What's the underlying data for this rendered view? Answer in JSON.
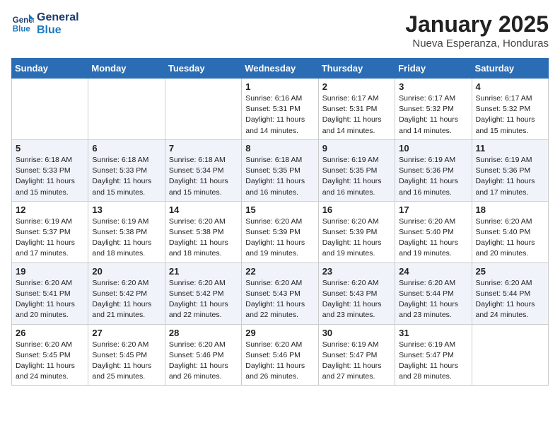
{
  "logo": {
    "line1": "General",
    "line2": "Blue"
  },
  "title": "January 2025",
  "location": "Nueva Esperanza, Honduras",
  "days_of_week": [
    "Sunday",
    "Monday",
    "Tuesday",
    "Wednesday",
    "Thursday",
    "Friday",
    "Saturday"
  ],
  "weeks": [
    [
      {
        "day": "",
        "info": ""
      },
      {
        "day": "",
        "info": ""
      },
      {
        "day": "",
        "info": ""
      },
      {
        "day": "1",
        "info": "Sunrise: 6:16 AM\nSunset: 5:31 PM\nDaylight: 11 hours and 14 minutes."
      },
      {
        "day": "2",
        "info": "Sunrise: 6:17 AM\nSunset: 5:31 PM\nDaylight: 11 hours and 14 minutes."
      },
      {
        "day": "3",
        "info": "Sunrise: 6:17 AM\nSunset: 5:32 PM\nDaylight: 11 hours and 14 minutes."
      },
      {
        "day": "4",
        "info": "Sunrise: 6:17 AM\nSunset: 5:32 PM\nDaylight: 11 hours and 15 minutes."
      }
    ],
    [
      {
        "day": "5",
        "info": "Sunrise: 6:18 AM\nSunset: 5:33 PM\nDaylight: 11 hours and 15 minutes."
      },
      {
        "day": "6",
        "info": "Sunrise: 6:18 AM\nSunset: 5:33 PM\nDaylight: 11 hours and 15 minutes."
      },
      {
        "day": "7",
        "info": "Sunrise: 6:18 AM\nSunset: 5:34 PM\nDaylight: 11 hours and 15 minutes."
      },
      {
        "day": "8",
        "info": "Sunrise: 6:18 AM\nSunset: 5:35 PM\nDaylight: 11 hours and 16 minutes."
      },
      {
        "day": "9",
        "info": "Sunrise: 6:19 AM\nSunset: 5:35 PM\nDaylight: 11 hours and 16 minutes."
      },
      {
        "day": "10",
        "info": "Sunrise: 6:19 AM\nSunset: 5:36 PM\nDaylight: 11 hours and 16 minutes."
      },
      {
        "day": "11",
        "info": "Sunrise: 6:19 AM\nSunset: 5:36 PM\nDaylight: 11 hours and 17 minutes."
      }
    ],
    [
      {
        "day": "12",
        "info": "Sunrise: 6:19 AM\nSunset: 5:37 PM\nDaylight: 11 hours and 17 minutes."
      },
      {
        "day": "13",
        "info": "Sunrise: 6:19 AM\nSunset: 5:38 PM\nDaylight: 11 hours and 18 minutes."
      },
      {
        "day": "14",
        "info": "Sunrise: 6:20 AM\nSunset: 5:38 PM\nDaylight: 11 hours and 18 minutes."
      },
      {
        "day": "15",
        "info": "Sunrise: 6:20 AM\nSunset: 5:39 PM\nDaylight: 11 hours and 19 minutes."
      },
      {
        "day": "16",
        "info": "Sunrise: 6:20 AM\nSunset: 5:39 PM\nDaylight: 11 hours and 19 minutes."
      },
      {
        "day": "17",
        "info": "Sunrise: 6:20 AM\nSunset: 5:40 PM\nDaylight: 11 hours and 19 minutes."
      },
      {
        "day": "18",
        "info": "Sunrise: 6:20 AM\nSunset: 5:40 PM\nDaylight: 11 hours and 20 minutes."
      }
    ],
    [
      {
        "day": "19",
        "info": "Sunrise: 6:20 AM\nSunset: 5:41 PM\nDaylight: 11 hours and 20 minutes."
      },
      {
        "day": "20",
        "info": "Sunrise: 6:20 AM\nSunset: 5:42 PM\nDaylight: 11 hours and 21 minutes."
      },
      {
        "day": "21",
        "info": "Sunrise: 6:20 AM\nSunset: 5:42 PM\nDaylight: 11 hours and 22 minutes."
      },
      {
        "day": "22",
        "info": "Sunrise: 6:20 AM\nSunset: 5:43 PM\nDaylight: 11 hours and 22 minutes."
      },
      {
        "day": "23",
        "info": "Sunrise: 6:20 AM\nSunset: 5:43 PM\nDaylight: 11 hours and 23 minutes."
      },
      {
        "day": "24",
        "info": "Sunrise: 6:20 AM\nSunset: 5:44 PM\nDaylight: 11 hours and 23 minutes."
      },
      {
        "day": "25",
        "info": "Sunrise: 6:20 AM\nSunset: 5:44 PM\nDaylight: 11 hours and 24 minutes."
      }
    ],
    [
      {
        "day": "26",
        "info": "Sunrise: 6:20 AM\nSunset: 5:45 PM\nDaylight: 11 hours and 24 minutes."
      },
      {
        "day": "27",
        "info": "Sunrise: 6:20 AM\nSunset: 5:45 PM\nDaylight: 11 hours and 25 minutes."
      },
      {
        "day": "28",
        "info": "Sunrise: 6:20 AM\nSunset: 5:46 PM\nDaylight: 11 hours and 26 minutes."
      },
      {
        "day": "29",
        "info": "Sunrise: 6:20 AM\nSunset: 5:46 PM\nDaylight: 11 hours and 26 minutes."
      },
      {
        "day": "30",
        "info": "Sunrise: 6:19 AM\nSunset: 5:47 PM\nDaylight: 11 hours and 27 minutes."
      },
      {
        "day": "31",
        "info": "Sunrise: 6:19 AM\nSunset: 5:47 PM\nDaylight: 11 hours and 28 minutes."
      },
      {
        "day": "",
        "info": ""
      }
    ]
  ]
}
